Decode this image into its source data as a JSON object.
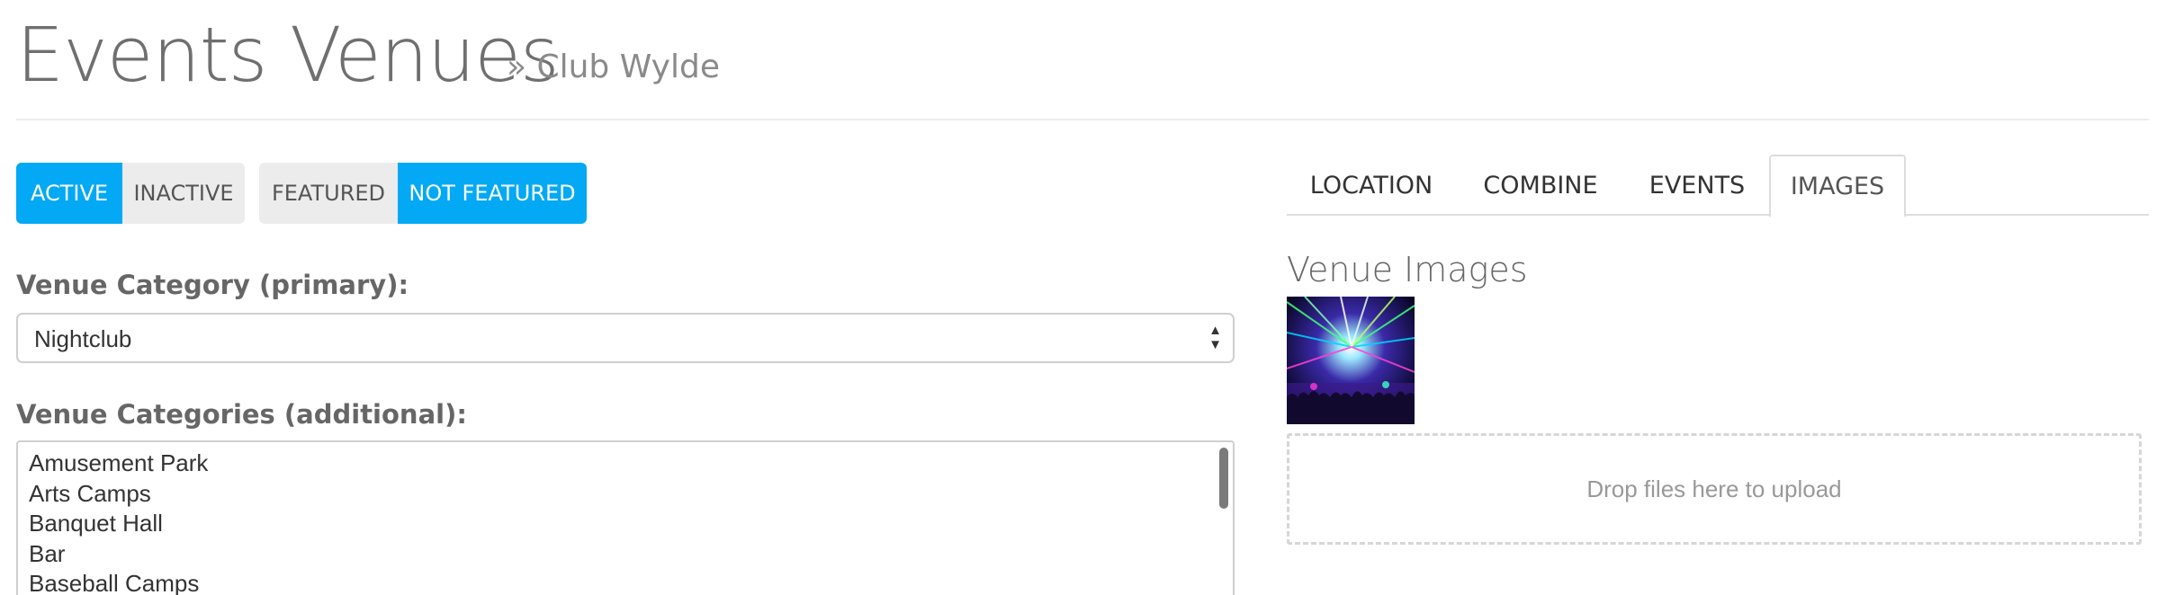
{
  "header": {
    "title": "Events Venues",
    "subtitle": "» Club Wylde"
  },
  "status_toggle": {
    "active_label": "ACTIVE",
    "inactive_label": "INACTIVE",
    "selected": "ACTIVE"
  },
  "featured_toggle": {
    "featured_label": "FEATURED",
    "not_featured_label": "NOT FEATURED",
    "selected": "NOT FEATURED"
  },
  "primary_category": {
    "label": "Venue Category (primary):",
    "value": "Nightclub"
  },
  "additional_categories": {
    "label": "Venue Categories (additional):",
    "options": [
      "Amusement Park",
      "Arts Camps",
      "Banquet Hall",
      "Bar",
      "Baseball Camps"
    ]
  },
  "tabs": [
    {
      "label": "LOCATION"
    },
    {
      "label": "COMBINE"
    },
    {
      "label": "EVENTS"
    },
    {
      "label": "IMAGES"
    }
  ],
  "active_tab": "IMAGES",
  "images_panel": {
    "title": "Venue Images",
    "dropzone_text": "Drop files here to upload"
  },
  "colors": {
    "accent": "#03a9f4",
    "inactive_button": "#ececec"
  }
}
